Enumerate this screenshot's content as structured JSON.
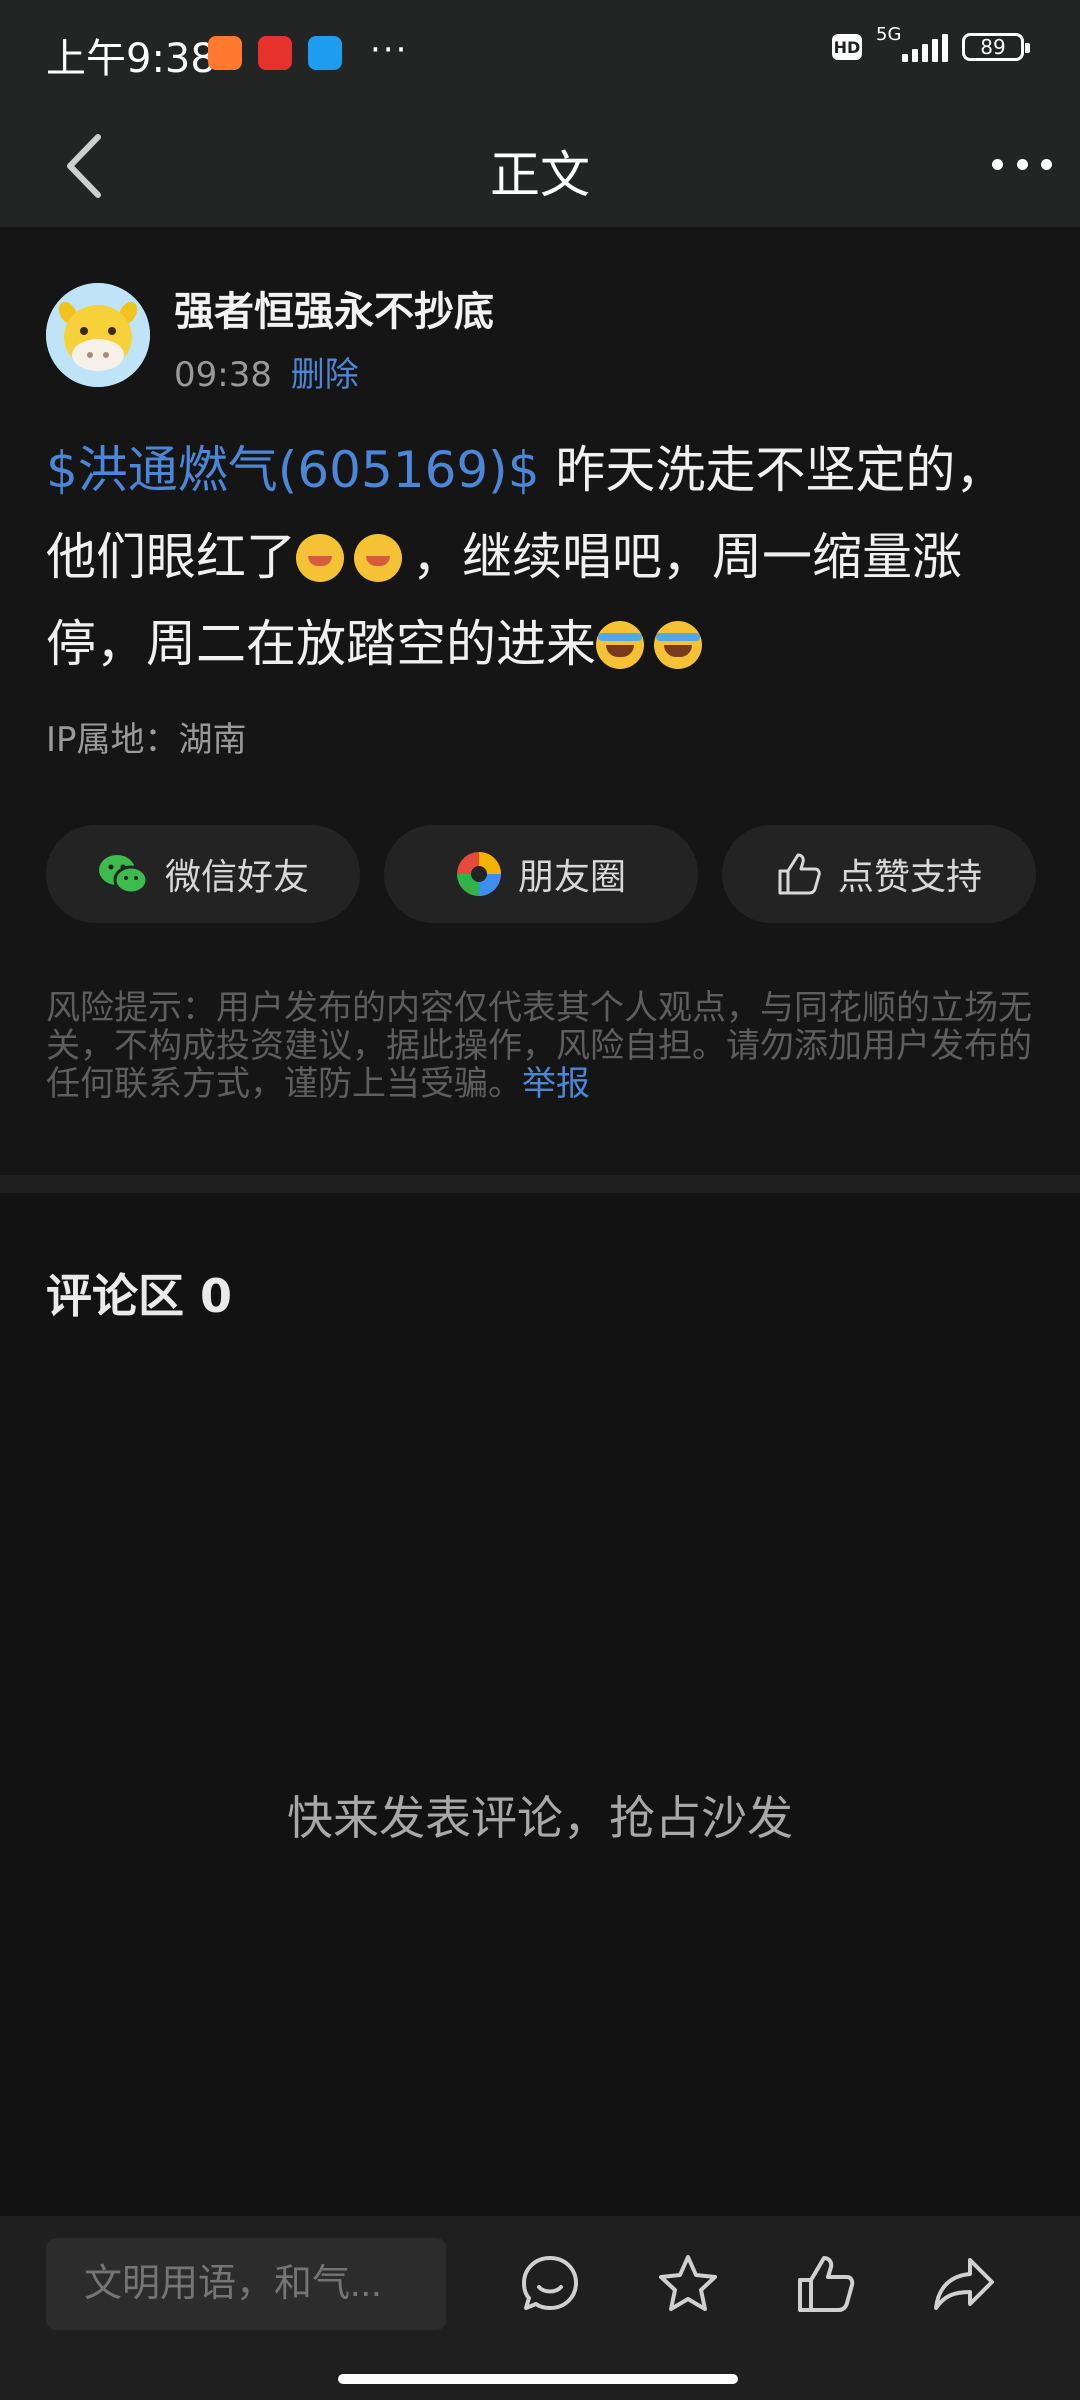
{
  "status_bar": {
    "time": "上午9:38",
    "more": "···",
    "hd": "HD",
    "network": "5G",
    "battery": "89"
  },
  "nav": {
    "title": "正文"
  },
  "post": {
    "author": "强者恒强永不抄底",
    "time": "09:38",
    "delete_label": "删除",
    "stock_tag": "$洪通燃气(605169)$",
    "text_part1": " 昨天洗走不坚定的，他们眼红了",
    "text_part2": "，继续唱吧，周一缩量涨停，周二在放踏空的进来",
    "ip_location": "IP属地：湖南"
  },
  "share": {
    "wechat_friend": "微信好友",
    "moments": "朋友圈",
    "like_support": "点赞支持"
  },
  "risk": {
    "text": "风险提示：用户发布的内容仅代表其个人观点，与同花顺的立场无关，不构成投资建议，据此操作，风险自担。请勿添加用户发布的任何联系方式，谨防上当受骗。",
    "report_label": "举报"
  },
  "comments": {
    "title": "评论区 0",
    "empty_tip": "快来发表评论，抢占沙发"
  },
  "bottom_bar": {
    "input_placeholder": "文明用语，和气..."
  },
  "colors": {
    "accent_blue": "#4c86d6",
    "background": "#121212",
    "bar_background": "#232525"
  }
}
